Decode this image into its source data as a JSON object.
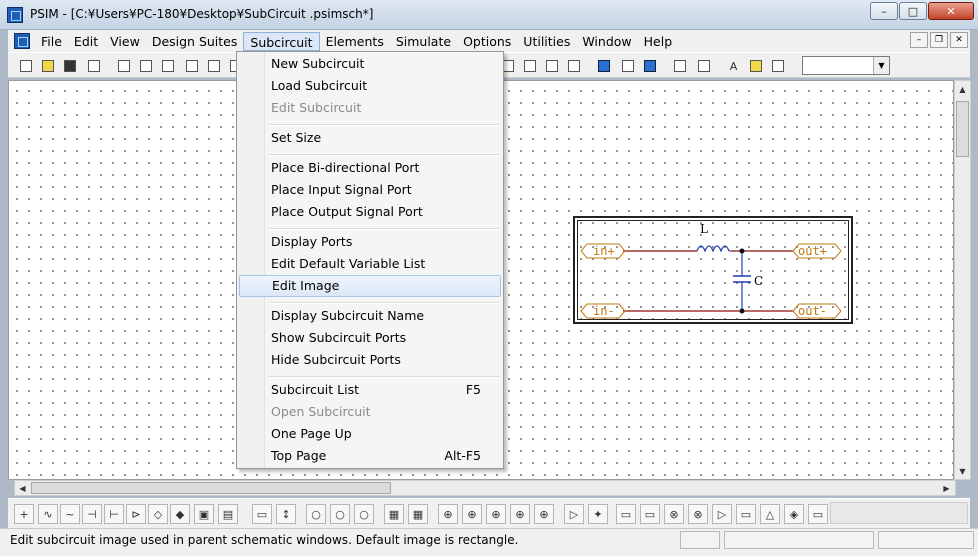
{
  "window": {
    "title": "PSIM - [C:¥Users¥PC-180¥Desktop¥SubCircuit .psimsch*]",
    "minimize_glyph": "–",
    "maximize_glyph": "□",
    "close_glyph": "✕"
  },
  "menubar": {
    "items": [
      "File",
      "Edit",
      "View",
      "Design Suites",
      "Subcircuit",
      "Elements",
      "Simulate",
      "Options",
      "Utilities",
      "Window",
      "Help"
    ],
    "active": "Subcircuit",
    "mdi_minimize": "–",
    "mdi_restore": "❐",
    "mdi_close": "✕"
  },
  "subcircuit_menu": {
    "items": [
      {
        "label": "New Subcircuit",
        "shortcut": "",
        "enabled": true
      },
      {
        "label": "Load Subcircuit",
        "shortcut": "",
        "enabled": true
      },
      {
        "label": "Edit Subcircuit",
        "shortcut": "",
        "enabled": false
      },
      {
        "label": "Set Size",
        "shortcut": "",
        "enabled": true
      },
      {
        "label": "Place Bi-directional Port",
        "shortcut": "",
        "enabled": true
      },
      {
        "label": "Place Input Signal Port",
        "shortcut": "",
        "enabled": true
      },
      {
        "label": "Place Output Signal Port",
        "shortcut": "",
        "enabled": true
      },
      {
        "label": "Display Ports",
        "shortcut": "",
        "enabled": true
      },
      {
        "label": "Edit Default Variable List",
        "shortcut": "",
        "enabled": true
      },
      {
        "label": "Edit Image",
        "shortcut": "",
        "enabled": true,
        "highlighted": true
      },
      {
        "label": "Display Subcircuit Name",
        "shortcut": "",
        "enabled": true
      },
      {
        "label": "Show Subcircuit Ports",
        "shortcut": "",
        "enabled": true
      },
      {
        "label": "Hide  Subcircuit Ports",
        "shortcut": "",
        "enabled": true
      },
      {
        "label": "Subcircuit List",
        "shortcut": "F5",
        "enabled": true
      },
      {
        "label": "Open Subcircuit",
        "shortcut": "",
        "enabled": false
      },
      {
        "label": "One Page Up",
        "shortcut": "",
        "enabled": true
      },
      {
        "label": "Top Page",
        "shortcut": "Alt-F5",
        "enabled": true
      }
    ]
  },
  "schematic": {
    "ports": {
      "in_top": "in+",
      "in_bottom": "in-",
      "out_top": "out+",
      "out_bottom": "out-"
    },
    "inductor_label": "L",
    "capacitor_label": "C",
    "wire_color": "#8b1010",
    "port_color": "#c07a10"
  },
  "statusbar": {
    "text": "Edit subcircuit image used in parent schematic windows. Default image is rectangle."
  },
  "toolbar": {
    "text_tool_glyph": "A"
  }
}
